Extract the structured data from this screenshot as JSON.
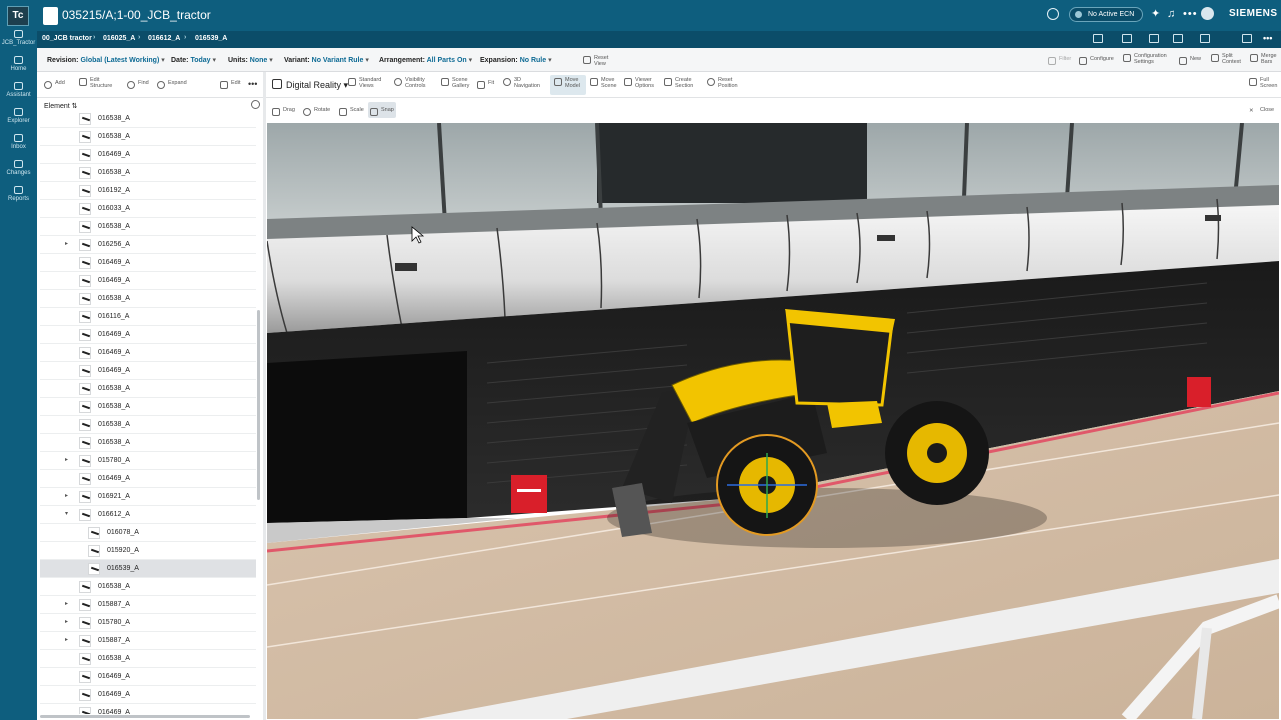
{
  "rail": {
    "logo": "Tc",
    "items": [
      {
        "name": "jcb-tractor",
        "label": "JCB_Tractor"
      },
      {
        "name": "home",
        "label": "Home"
      },
      {
        "name": "assistant",
        "label": "Assistant"
      },
      {
        "name": "explorer",
        "label": "Explorer"
      },
      {
        "name": "inbox",
        "label": "Inbox"
      },
      {
        "name": "changes",
        "label": "Changes"
      },
      {
        "name": "reports",
        "label": "Reports"
      }
    ]
  },
  "header": {
    "title": "035215/A;1-00_JCB_tractor",
    "ecn": "No Active ECN",
    "brand": "SIEMENS"
  },
  "breadcrumb": [
    "00_JCB tractor",
    "016025_A",
    "016612_A",
    "016539_A"
  ],
  "config": {
    "revision": {
      "label": "Revision:",
      "value": "Global (Latest Working)"
    },
    "date": {
      "label": "Date:",
      "value": "Today"
    },
    "units": {
      "label": "Units:",
      "value": "None"
    },
    "variant": {
      "label": "Variant:",
      "value": "No Variant Rule"
    },
    "arrangement": {
      "label": "Arrangement:",
      "value": "All Parts On"
    },
    "expansion": {
      "label": "Expansion:",
      "value": "No Rule"
    },
    "reset_view": "Reset View",
    "right_tools": [
      "Filter",
      "Configure",
      "Configuration Settings",
      "New",
      "Split Context",
      "Merge Bars"
    ]
  },
  "left_tools": [
    "Add",
    "Edit Structure",
    "Find",
    "Expand",
    "Edit"
  ],
  "table": {
    "column": "Element",
    "rows": [
      {
        "label": "016538_A",
        "indent": 0,
        "expander": ""
      },
      {
        "label": "016538_A",
        "indent": 0,
        "expander": ""
      },
      {
        "label": "016469_A",
        "indent": 0,
        "expander": ""
      },
      {
        "label": "016538_A",
        "indent": 0,
        "expander": ""
      },
      {
        "label": "016192_A",
        "indent": 0,
        "expander": ""
      },
      {
        "label": "016033_A",
        "indent": 0,
        "expander": ""
      },
      {
        "label": "016538_A",
        "indent": 0,
        "expander": ""
      },
      {
        "label": "016256_A",
        "indent": 0,
        "expander": "▸"
      },
      {
        "label": "016469_A",
        "indent": 0,
        "expander": ""
      },
      {
        "label": "016469_A",
        "indent": 0,
        "expander": ""
      },
      {
        "label": "016538_A",
        "indent": 0,
        "expander": ""
      },
      {
        "label": "016116_A",
        "indent": 0,
        "expander": ""
      },
      {
        "label": "016469_A",
        "indent": 0,
        "expander": ""
      },
      {
        "label": "016469_A",
        "indent": 0,
        "expander": ""
      },
      {
        "label": "016469_A",
        "indent": 0,
        "expander": ""
      },
      {
        "label": "016538_A",
        "indent": 0,
        "expander": ""
      },
      {
        "label": "016538_A",
        "indent": 0,
        "expander": ""
      },
      {
        "label": "016538_A",
        "indent": 0,
        "expander": ""
      },
      {
        "label": "016538_A",
        "indent": 0,
        "expander": ""
      },
      {
        "label": "015780_A",
        "indent": 0,
        "expander": "▸"
      },
      {
        "label": "016469_A",
        "indent": 0,
        "expander": ""
      },
      {
        "label": "016921_A",
        "indent": 0,
        "expander": "▸"
      },
      {
        "label": "016612_A",
        "indent": 0,
        "expander": "▾"
      },
      {
        "label": "016078_A",
        "indent": 1,
        "expander": ""
      },
      {
        "label": "015920_A",
        "indent": 1,
        "expander": ""
      },
      {
        "label": "016539_A",
        "indent": 1,
        "expander": "",
        "selected": true
      },
      {
        "label": "016538_A",
        "indent": 0,
        "expander": ""
      },
      {
        "label": "015887_A",
        "indent": 0,
        "expander": "▸"
      },
      {
        "label": "015780_A",
        "indent": 0,
        "expander": "▸"
      },
      {
        "label": "015887_A",
        "indent": 0,
        "expander": "▸"
      },
      {
        "label": "016538_A",
        "indent": 0,
        "expander": ""
      },
      {
        "label": "016469_A",
        "indent": 0,
        "expander": ""
      },
      {
        "label": "016469_A",
        "indent": 0,
        "expander": ""
      },
      {
        "label": "016469_A",
        "indent": 0,
        "expander": ""
      }
    ]
  },
  "viewer": {
    "mode": "Digital Reality",
    "tools": [
      "Standard Views",
      "Visibility Controls",
      "Scene Gallery",
      "Fit",
      "3D Navigation",
      "Move Model",
      "Move Scene",
      "Viewer Options",
      "Create Section",
      "Reset Position"
    ],
    "active_tool": "Move Model",
    "full_screen": "Full Screen",
    "subtools": [
      "Drag",
      "Rotate",
      "Scale",
      "Snap"
    ],
    "active_subtool": "Snap",
    "close": "Close"
  },
  "colors": {
    "brand": "#0e5e7e",
    "brand_dark": "#0b4d69",
    "accent": "#0d6a94",
    "tractor_yellow": "#f2c400",
    "red_marker": "#d91f2a"
  }
}
